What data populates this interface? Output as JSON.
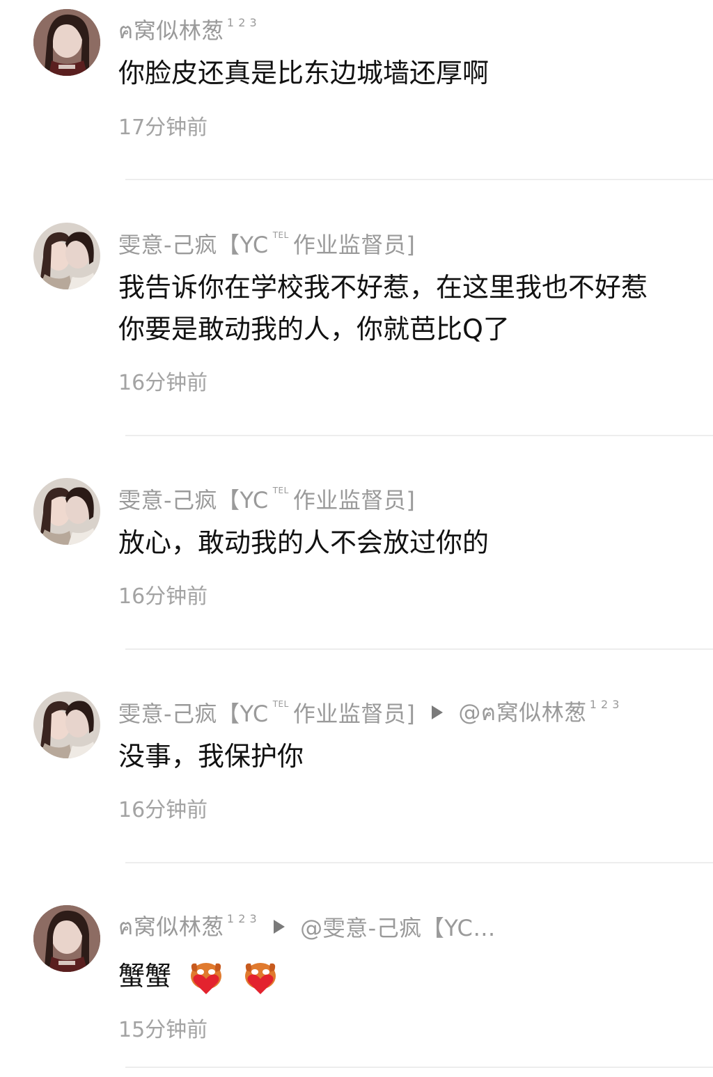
{
  "users": {
    "wo": {
      "name": "ฅ窝似林葱",
      "sup": "1 2 3"
    },
    "wen": {
      "name_pre": "雯意-己疯【YC",
      "tel": "TEL",
      "name_post": "作业监督员]"
    }
  },
  "comments": [
    {
      "text": "你脸皮还真是比东边城墙还厚啊",
      "time": "17分钟前"
    },
    {
      "line1": "我告诉你在学校我不好惹，在这里我也不好惹",
      "line2": "你要是敢动我的人，你就芭比Q了",
      "time": "16分钟前"
    },
    {
      "text": "放心，敢动我的人不会放过你的",
      "time": "16分钟前"
    },
    {
      "reply_to": "@ฅ窝似林葱",
      "reply_sup": "1 2 3",
      "text": "没事，我保护你",
      "time": "16分钟前"
    },
    {
      "reply_to": "@雯意-己疯【YC…",
      "text": "蟹蟹",
      "emojis": [
        "heart-hug-emoji",
        "heart-hug-emoji"
      ],
      "time": "15分钟前"
    }
  ],
  "colors": {
    "name": "#9a9a9a",
    "text": "#111111",
    "time": "#a3a3a3",
    "divider": "#ededed"
  }
}
